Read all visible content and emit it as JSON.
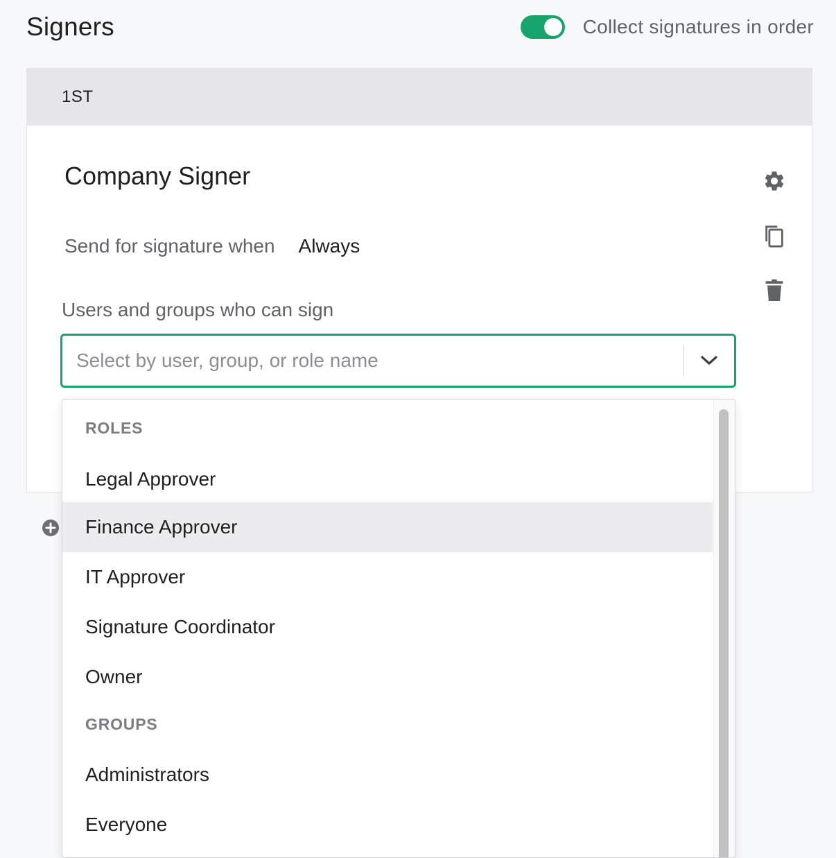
{
  "header": {
    "title": "Signers",
    "toggle_label": "Collect signatures in order",
    "toggle_on": true
  },
  "card": {
    "order_label": "1ST",
    "signer_name": "Company Signer",
    "send_label": "Send for signature when",
    "send_value": "Always",
    "users_label": "Users and groups who can sign",
    "select_placeholder": "Select by user, group, or role name",
    "icons": [
      "gear-icon",
      "copy-icon",
      "trash-icon"
    ]
  },
  "dropdown": {
    "roles_header": "ROLES",
    "roles": [
      "Legal Approver",
      "Finance Approver",
      "IT Approver",
      "Signature Coordinator",
      "Owner"
    ],
    "groups_header": "GROUPS",
    "groups": [
      "Administrators",
      "Everyone"
    ],
    "highlighted": "Finance Approver"
  },
  "colors": {
    "accent": "#16a46b",
    "card_header_bg": "#e5e5ea",
    "highlight_bg": "#ececef"
  }
}
